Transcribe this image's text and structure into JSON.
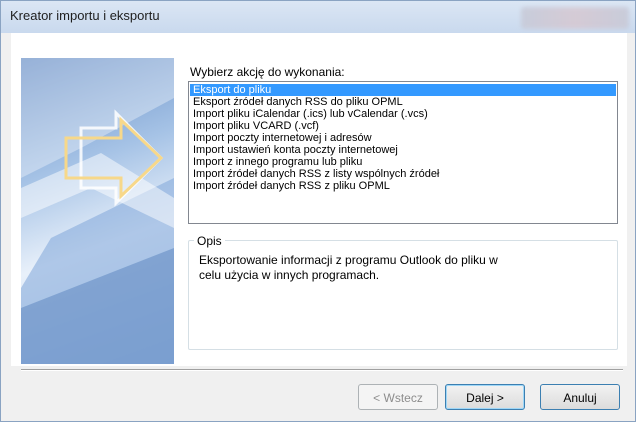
{
  "window": {
    "title": "Kreator importu i eksportu"
  },
  "actions": {
    "prompt": "Wybierz akcję do wykonania:",
    "items": [
      {
        "label": "Eksport do pliku",
        "selected": true
      },
      {
        "label": "Eksport źródeł danych RSS do pliku OPML",
        "selected": false
      },
      {
        "label": "Import pliku iCalendar (.ics) lub vCalendar (.vcs)",
        "selected": false
      },
      {
        "label": "Import pliku VCARD (.vcf)",
        "selected": false
      },
      {
        "label": "Import poczty internetowej i adresów",
        "selected": false
      },
      {
        "label": "Import ustawień konta poczty internetowej",
        "selected": false
      },
      {
        "label": "Import z innego programu lub pliku",
        "selected": false
      },
      {
        "label": "Import źródeł danych RSS z listy wspólnych źródeł",
        "selected": false
      },
      {
        "label": "Import źródeł danych RSS z pliku OPML",
        "selected": false
      }
    ]
  },
  "description": {
    "legend": "Opis",
    "text": "Eksportowanie informacji z programu Outlook do pliku w celu użycia w innych programach."
  },
  "buttons": {
    "back": "< Wstecz",
    "next": "Dalej >",
    "cancel": "Anuluj"
  },
  "colors": {
    "selection": "#3399ff",
    "artwork_arrow": "#f7d88a"
  }
}
